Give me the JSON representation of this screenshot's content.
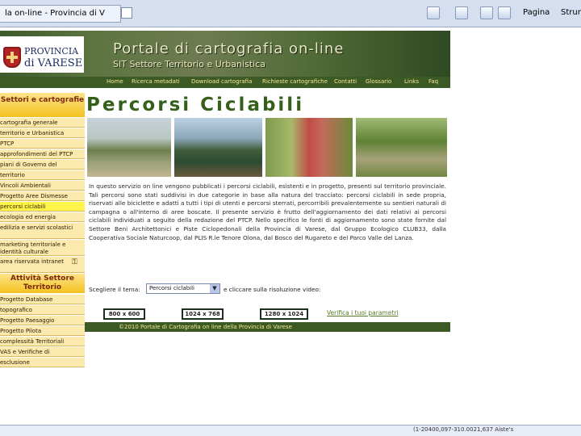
{
  "browser": {
    "tab_title": "la on-line - Provincia di V",
    "toolbar": {
      "page_label": "Pagina",
      "tools_label": "Strum"
    },
    "status_text": "(1-20400,097-310.0021,637 Aiste's"
  },
  "logo": {
    "line1": "PROVINCIA",
    "line2": "di VARESE"
  },
  "header": {
    "title": "Portale di cartografia on-line",
    "subtitle": "SIT Settore Territorio e Urbanistica"
  },
  "topnav": [
    "Home",
    "Ricerca metadati",
    "Download cartografia",
    "Richieste cartografiche",
    "Contatti",
    "Glossario",
    "Links",
    "Faq"
  ],
  "sidebar": {
    "section1_title": "Settori e cartografie",
    "items1": [
      "cartografia generale",
      "territorio e Urbanistica",
      "PTCP",
      "approfondimenti del PTCP",
      "piani di Governo del",
      "territorio",
      "Vincoli Ambientali",
      "Progetto Aree Dismesse",
      "percorsi ciclabili",
      "ecologia ed energia",
      "edilizia e servizi scolastici",
      "marketing territoriale e identità culturale",
      "area riservata intranet"
    ],
    "section2_title": "Attività Settore Territorio",
    "items2": [
      "Progetto Database",
      "topografico",
      "Progetto Paesaggio",
      "Progetto Pilota",
      "complessità Territoriali",
      "VAS e Verifiche di",
      "esclusione"
    ]
  },
  "content": {
    "title": "Percorsi Ciclabili",
    "body": "In questo servizio on line vengono pubblicati i percorsi ciclabili, esistenti e in progetto, presenti sul territorio provinciale. Tali percorsi sono stati suddivisi in due categorie in base alla natura del tracciato: percorsi ciclabili in sede propria, riservati alle biciclette e adatti a tutti i tipi di utenti e percorsi sterrati, percorribili prevalentemente su sentieri naturali di campagna o all'interno di aree boscate. Il presente servizio è frutto dell'aggiornamento dei dati relativi ai percorsi ciclabili individuati a seguito della redazione del PTCP. Nello specifico le fonti di aggiornamento sono state fornite dal Settore Beni Architettonici e Piste Ciclopedonali della Provincia di Varese, dal Gruppo Ecologico CLUB33, dalla Cooperativa Sociale Naturcoop, dal PLIS R.le Tenore Olona, dal Bosco del Rugareto e del Parco Valle del Lanza.",
    "choose_prefix": "Scegliere il tema:",
    "theme_value": "Percorsi ciclabili",
    "choose_suffix": "e cliccare sulla risoluzione video:",
    "resolutions": [
      "800 x 600",
      "1024 x 768",
      "1280 x 1024"
    ],
    "verify_link": "Verifica i tuoi parametri",
    "footer": "©2010 Portale di Cartografia on line della Provincia di Varese"
  },
  "colors": {
    "nav_bg": "#3c5a23",
    "nav_text": "#f5e79a",
    "sidebar_item": "#fbe9ad",
    "sidebar_active": "#fff44a",
    "title_green": "#365f1a"
  }
}
